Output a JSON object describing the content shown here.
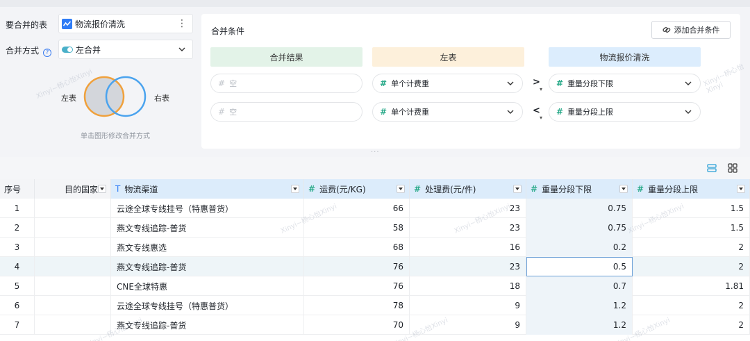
{
  "config": {
    "merge_table_label": "要合并的表",
    "merge_table_value": "物流报价清洗",
    "merge_mode_label": "合并方式",
    "merge_mode_value": "左合并",
    "venn_left_label": "左表",
    "venn_right_label": "右表",
    "venn_hint": "单击图形修改合并方式"
  },
  "conditions": {
    "title": "合并条件",
    "add_button": "添加合并条件",
    "headers": {
      "result": "合并结果",
      "left": "左表",
      "right": "物流报价清洗"
    },
    "rows": [
      {
        "result": "空",
        "left": "单个计费重",
        "op": ">",
        "right": "重量分段下限"
      },
      {
        "result": "空",
        "left": "单个计费重",
        "op": "<",
        "right": "重量分段上限"
      }
    ]
  },
  "grid": {
    "columns": [
      {
        "key": "idx",
        "label": "序号"
      },
      {
        "key": "country",
        "label": "目的国家"
      },
      {
        "key": "channel",
        "label": "物流渠道",
        "type_icon": "T"
      },
      {
        "key": "freight",
        "label": "运费(元/KG)",
        "type_icon": "#"
      },
      {
        "key": "handling",
        "label": "处理费(元/件)",
        "type_icon": "#"
      },
      {
        "key": "lower",
        "label": "重量分段下限",
        "type_icon": "#"
      },
      {
        "key": "upper",
        "label": "重量分段上限",
        "type_icon": "#"
      }
    ],
    "rows": [
      {
        "idx": "1",
        "country": "",
        "channel": "云途全球专线挂号（特惠普货）",
        "freight": "66",
        "handling": "23",
        "lower": "0.75",
        "upper": "1.5"
      },
      {
        "idx": "2",
        "country": "",
        "channel": "燕文专线追踪-普货",
        "freight": "58",
        "handling": "23",
        "lower": "0.75",
        "upper": "1.5"
      },
      {
        "idx": "3",
        "country": "",
        "channel": "燕文专线惠选",
        "freight": "68",
        "handling": "16",
        "lower": "0.2",
        "upper": "2"
      },
      {
        "idx": "4",
        "country": "",
        "channel": "燕文专线追踪-普货",
        "freight": "76",
        "handling": "23",
        "lower": "0.5",
        "upper": "2"
      },
      {
        "idx": "5",
        "country": "",
        "channel": "CNE全球特惠",
        "freight": "76",
        "handling": "18",
        "lower": "0.7",
        "upper": "1.81"
      },
      {
        "idx": "6",
        "country": "",
        "channel": "云途全球专线挂号（特惠普货）",
        "freight": "78",
        "handling": "9",
        "lower": "1.2",
        "upper": "2"
      },
      {
        "idx": "7",
        "country": "",
        "channel": "燕文专线追踪-普货",
        "freight": "70",
        "handling": "9",
        "lower": "1.2",
        "upper": "2"
      }
    ]
  },
  "watermark": "Xinyi~杨心怡Xinyi",
  "colors": {
    "accent": "#2f7cf6",
    "number_type": "#2aaa8a",
    "venn_left": "#f0a13c",
    "venn_right": "#4aa3ee"
  }
}
